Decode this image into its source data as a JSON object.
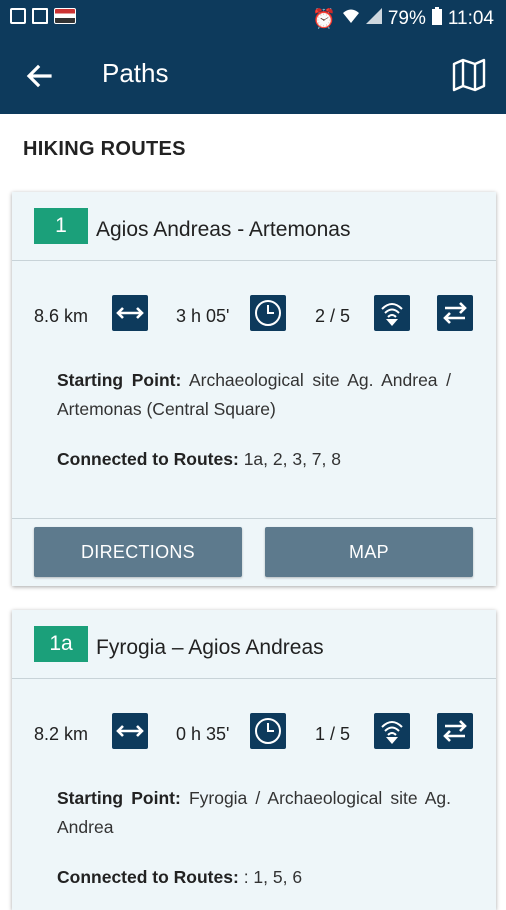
{
  "status_bar": {
    "battery": "79%",
    "time": "11:04"
  },
  "app_bar": {
    "title": "Paths"
  },
  "section_title": "HIKING ROUTES",
  "routes": [
    {
      "number": "1",
      "name": "Agios Andreas - Artemonas",
      "distance": "8.6 km",
      "duration": "3 h 05'",
      "difficulty": "2 / 5",
      "starting_point_label": "Starting Point:",
      "starting_point": "Archaeological site Ag. Andrea / Artemonas (Central Square)",
      "connected_label": "Connected to Routes:",
      "connected": "1a, 2, 3, 7, 8",
      "directions_label": "DIRECTIONS",
      "map_label": "MAP"
    },
    {
      "number": "1a",
      "name": "Fyrogia – Agios Andreas",
      "distance": "8.2 km",
      "duration": "0 h 35'",
      "difficulty": "1 / 5",
      "starting_point_label": "Starting Point:",
      "starting_point": "Fyrogia / Archaeological site Ag. Andrea",
      "connected_label": "Connected to Routes:",
      "connected": ": 1, 5, 6"
    }
  ]
}
